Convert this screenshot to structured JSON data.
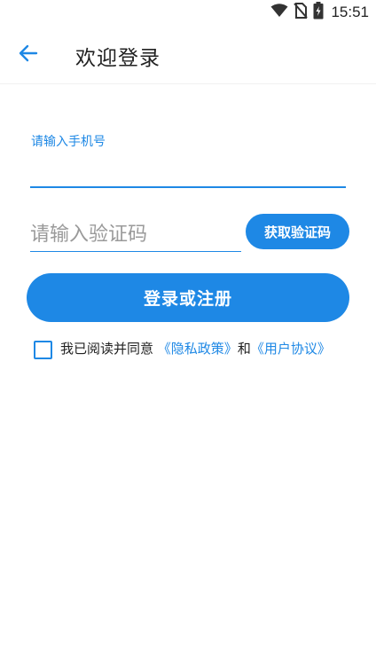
{
  "status_bar": {
    "time": "15:51",
    "icons": [
      "wifi-icon",
      "no-sim-icon",
      "battery-charging-icon"
    ]
  },
  "app_bar": {
    "back_icon": "arrow-left-icon",
    "title": "欢迎登录"
  },
  "form": {
    "phone_label": "请输入手机号",
    "phone_value": "",
    "code_placeholder": "请输入验证码",
    "code_value": "",
    "get_code_label": "获取验证码",
    "login_label": "登录或注册"
  },
  "agreement": {
    "checked": false,
    "prefix": "我已阅读并同意",
    "privacy_link": "《隐私政策》",
    "conjunction": "和",
    "user_link": "《用户协议》"
  },
  "colors": {
    "accent": "#1e88e5",
    "text": "#222222",
    "placeholder": "#9a9a9a"
  }
}
